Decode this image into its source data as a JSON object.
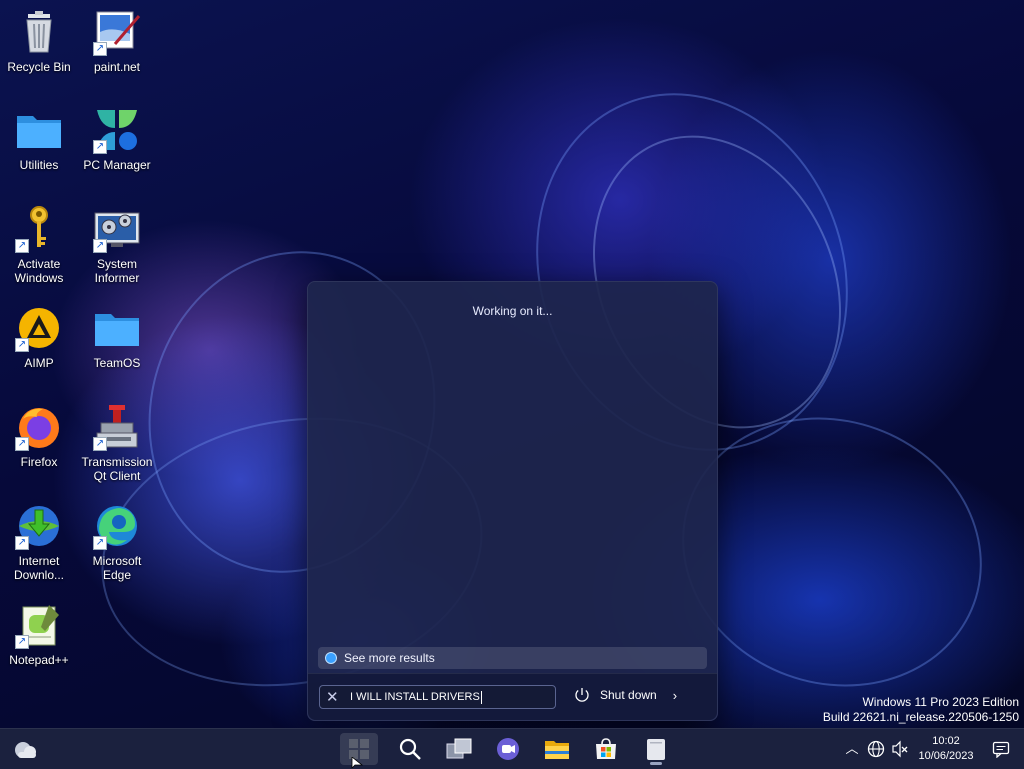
{
  "desktop": {
    "icons": [
      {
        "label": "Recycle Bin",
        "icon": "recycle-bin-icon"
      },
      {
        "label": "paint.net",
        "icon": "paintnet-icon"
      },
      {
        "label": "Utilities",
        "icon": "folder-icon"
      },
      {
        "label": "PC Manager",
        "icon": "pc-manager-icon"
      },
      {
        "label": "Activate Windows",
        "icon": "key-icon"
      },
      {
        "label": "System Informer",
        "icon": "system-informer-icon"
      },
      {
        "label": "AIMP",
        "icon": "aimp-icon"
      },
      {
        "label": "TeamOS",
        "icon": "folder-icon"
      },
      {
        "label": "Firefox",
        "icon": "firefox-icon"
      },
      {
        "label": "Transmission Qt Client",
        "icon": "transmission-icon"
      },
      {
        "label": "Internet Downlo...",
        "icon": "idm-icon"
      },
      {
        "label": "Microsoft Edge",
        "icon": "edge-icon"
      },
      {
        "label": "Notepad++",
        "icon": "notepadpp-icon"
      }
    ]
  },
  "search_panel": {
    "status": "Working on it...",
    "see_more": "See more results",
    "query": "I WILL INSTALL DRIVERS",
    "power_label": "Shut down"
  },
  "watermark": {
    "line1": "Windows 11 Pro 2023 Edition",
    "line2": "Build 22621.ni_release.220506-1250"
  },
  "taskbar": {
    "time": "10:02",
    "date": "10/06/2023"
  },
  "colors": {
    "accent": "#3aa0ff",
    "panel_bg": "#1e264e",
    "taskbar_bg": "#1c2240"
  }
}
